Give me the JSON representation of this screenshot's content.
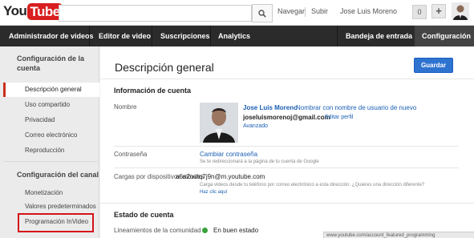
{
  "logo": {
    "you": "You",
    "tube": "Tube"
  },
  "search": {
    "placeholder": ""
  },
  "top_links": {
    "browse": "Navegar",
    "upload": "Subir"
  },
  "user": {
    "name": "Jose Luis Moreno",
    "notification_count": "0",
    "plus": "+"
  },
  "nav": {
    "video_manager": "Administrador de videos",
    "video_editor": "Editor de video",
    "subscriptions": "Suscripciones",
    "analytics": "Analytics",
    "inbox": "Bandeja de entrada",
    "settings": "Configuración"
  },
  "sidebar": {
    "account_header": "Configuración de la cuenta",
    "account_items": [
      "Descripción general",
      "Uso compartido",
      "Privacidad",
      "Correo electrónico",
      "Reproducción"
    ],
    "channel_header": "Configuración del canal",
    "channel_items": [
      "Monetización",
      "Valores predeterminados",
      "Programación InVideo"
    ]
  },
  "main": {
    "title": "Descripción general",
    "save_label": "Guardar",
    "account_info_header": "Información de cuenta",
    "name_label": "Nombre",
    "profile_name": "Jose Luis Moreno",
    "rename_link": "Nombrar con nombre de usuario de nuevo",
    "email": "joseluismorenoj@gmail.com",
    "edit_profile": "Editar perfil",
    "advanced": "Avanzado",
    "password_label": "Contraseña",
    "change_password": "Cambiar contraseña",
    "password_note": "Se te redireccionará a la página de tu cuenta de Google",
    "mobile_upload_label": "Cargas por dispositivos móviles",
    "mobile_upload_email": "a6a2outq7j9n@m.youtube.com",
    "mobile_upload_note": "Carga videos desde tu teléfono por correo electrónico a esta dirección. ¿Quieres una dirección diferente?",
    "why_link": "Haz clic aquí",
    "account_status_header": "Estado de cuenta",
    "community_label": "Lineamientos de la comunidad",
    "community_status": "En buen estado"
  },
  "status_bar_url": "www.youtube.com/account_featured_programming",
  "colors": {
    "accent_red": "#d4121a",
    "link_blue": "#1a5fb4",
    "save_blue": "#2f73d1",
    "status_green": "#39a339",
    "nav_dark": "#2b2b2b"
  }
}
